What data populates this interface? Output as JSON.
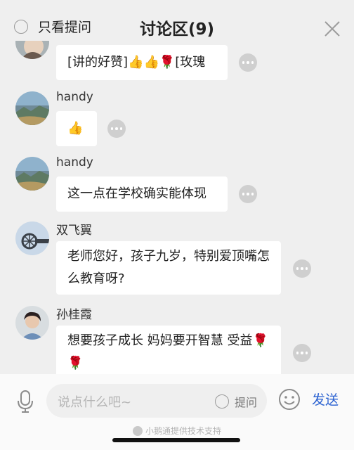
{
  "header": {
    "only_questions_label": "只看提问",
    "title": "讨论区(9)"
  },
  "messages": [
    {
      "username": "",
      "text": "[讲的好赞]👍👍🌹[玫瑰",
      "avatar": "avatar-partial"
    },
    {
      "username": "handy",
      "text": "👍",
      "avatar": "landscape-avatar"
    },
    {
      "username": "handy",
      "text": "这一点在学校确实能体现",
      "avatar": "landscape-avatar"
    },
    {
      "username": "双飞翼",
      "text": "老师您好，孩子九岁，特别爱顶嘴怎么教育呀?",
      "avatar": "sky-avatar"
    },
    {
      "username": "孙桂霞",
      "text": "想要孩子成长 妈妈要开智慧 受益🌹🌹",
      "avatar": "person-avatar"
    }
  ],
  "compose": {
    "placeholder": "说点什么吧~",
    "question_label": "提问",
    "send_label": "发送"
  },
  "footer": {
    "powered_by": "小鹅通提供技术支持"
  }
}
